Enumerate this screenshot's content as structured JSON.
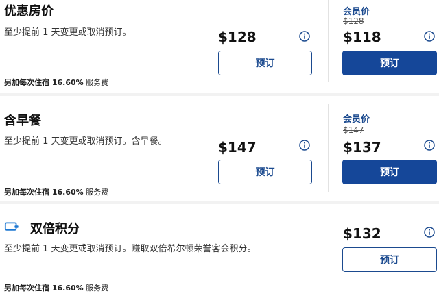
{
  "rates": [
    {
      "title": "优惠房价",
      "description": "至少提前 1 天变更或取消预订。",
      "fee_prefix": "另加每次住宿 ",
      "fee_percent": "16.60%",
      "fee_suffix": " 服务费",
      "price": "$128",
      "book_label": "预订",
      "member_label": "会员价",
      "member_original_price": "$128",
      "member_price": "$118",
      "member_book_label": "预订"
    },
    {
      "title": "含早餐",
      "description": "至少提前 1 天变更或取消预订。含早餐。",
      "fee_prefix": "另加每次住宿 ",
      "fee_percent": "16.60%",
      "fee_suffix": " 服务费",
      "price": "$147",
      "book_label": "预订",
      "member_label": "会员价",
      "member_original_price": "$147",
      "member_price": "$137",
      "member_book_label": "预订"
    },
    {
      "title": "双倍积分",
      "description": "至少提前 1 天变更或取消预订。赚取双倍希尔顿荣誉客会积分。",
      "fee_prefix": "另加每次住宿 ",
      "fee_percent": "16.60%",
      "fee_suffix": " 服务费",
      "price": "$132",
      "book_label": "预订"
    }
  ],
  "colors": {
    "brand_blue": "#154799",
    "text": "#111111"
  },
  "icons": {
    "info": "info-icon",
    "points": "points-card-icon"
  }
}
